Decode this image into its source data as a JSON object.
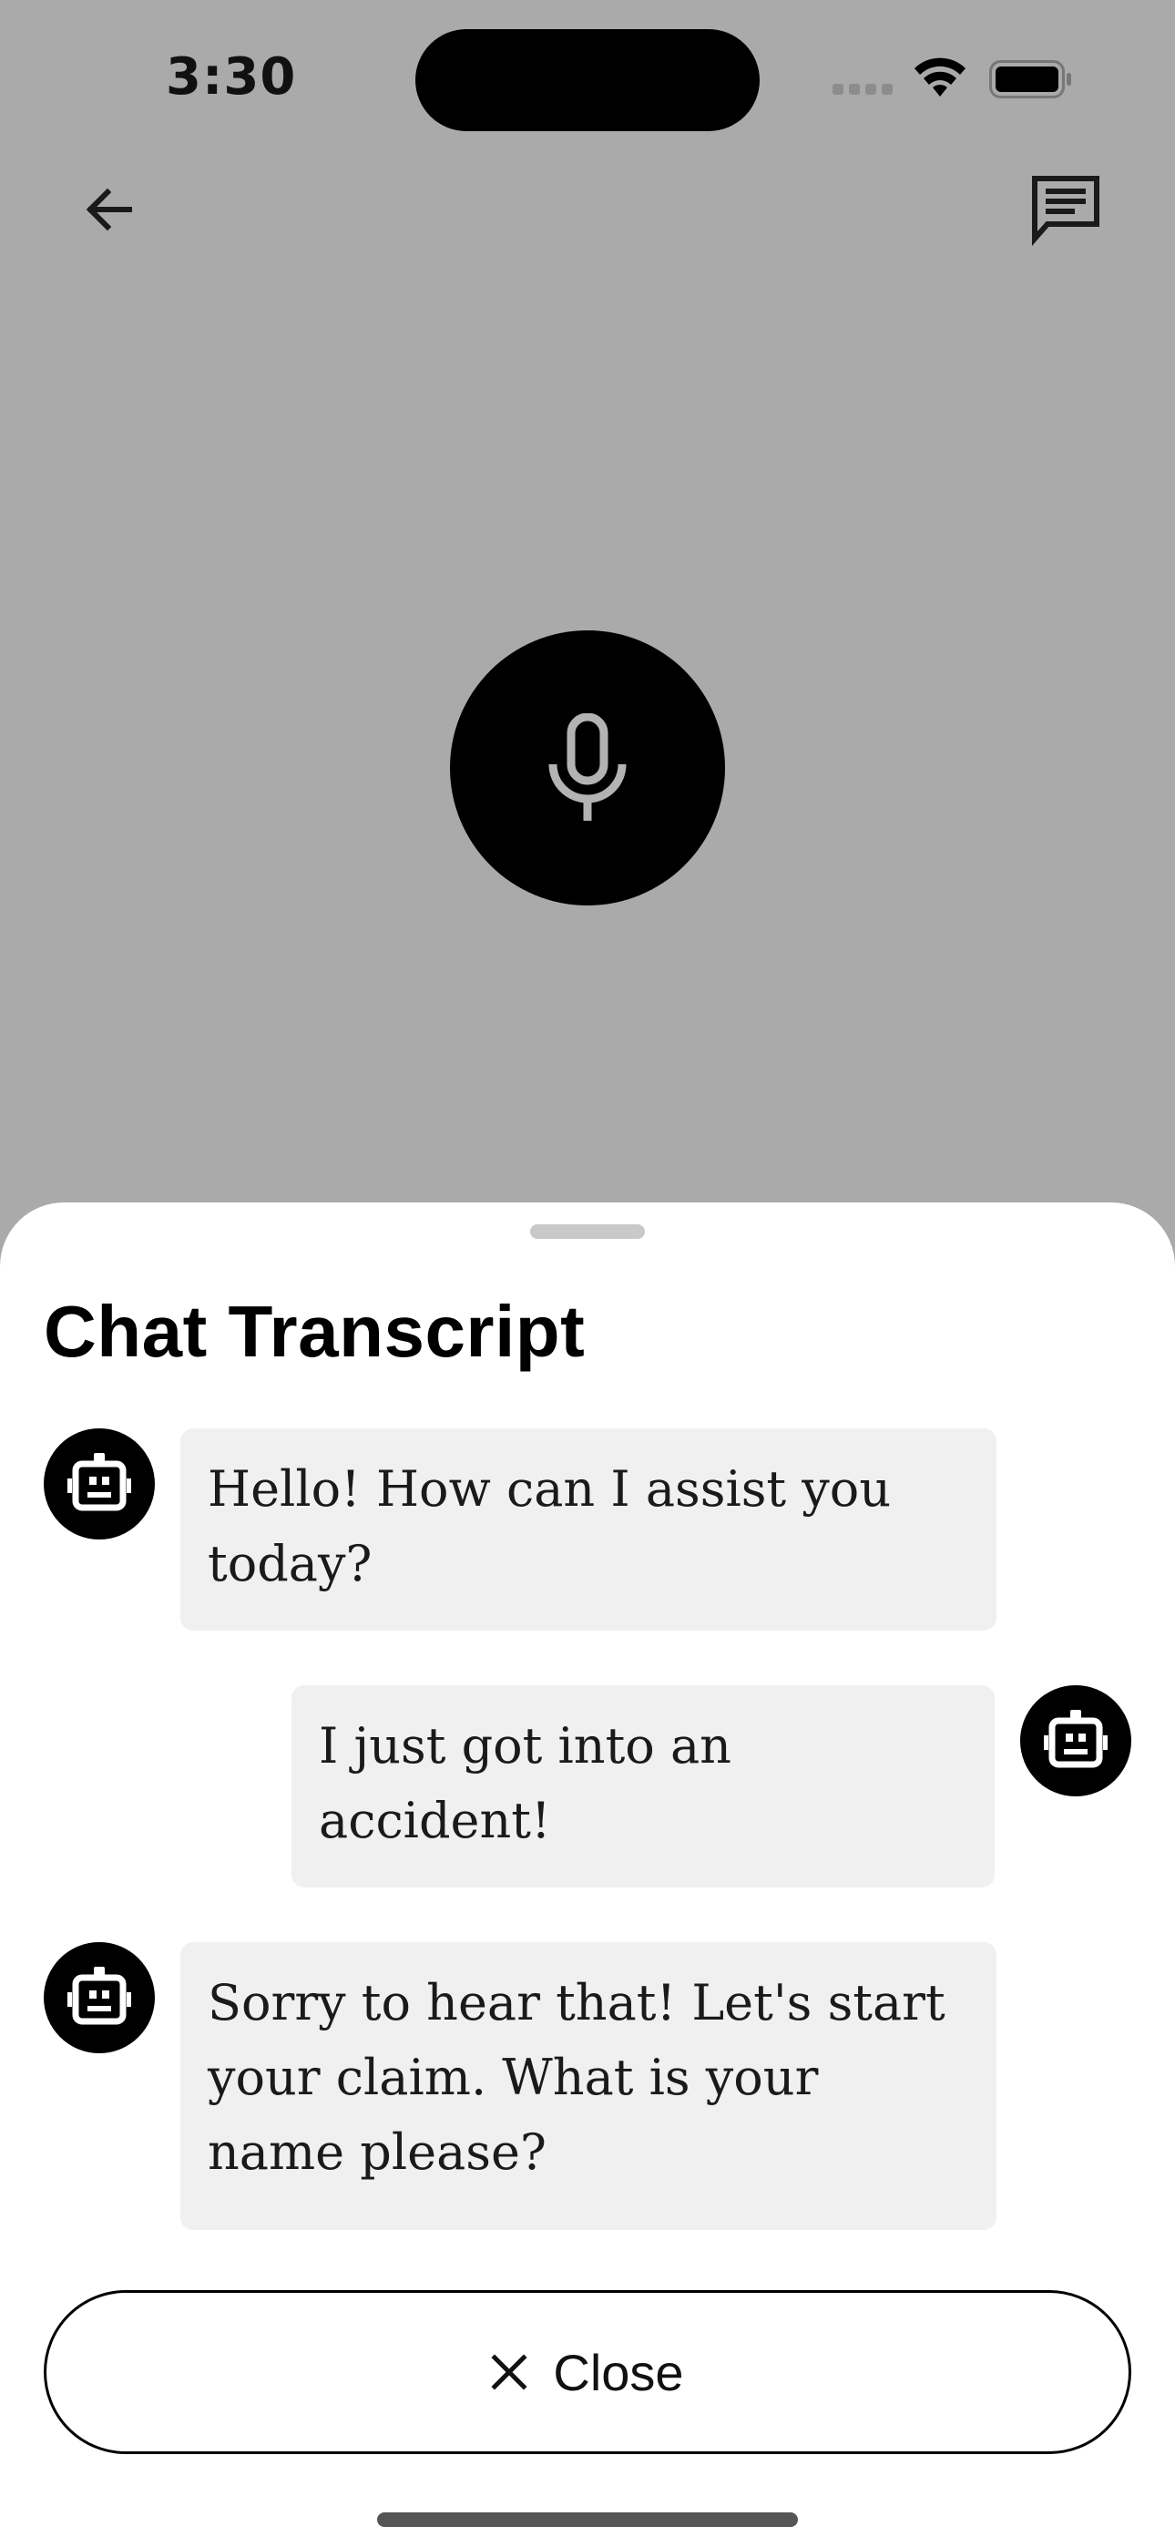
{
  "status_bar": {
    "time": "3:30"
  },
  "header": {
    "back_icon": "arrow-left-icon",
    "chat_icon": "chat-message-icon"
  },
  "voice": {
    "mic_icon": "microphone-icon"
  },
  "transcript": {
    "title": "Chat Transcript",
    "messages": [
      {
        "sender": "bot",
        "text": "Hello! How can I assist you today?"
      },
      {
        "sender": "user",
        "text": "I just got into an accident!"
      },
      {
        "sender": "bot",
        "text": "Sorry to hear that! Let's start your claim. What is your name please?"
      }
    ],
    "avatar_icon": "robot-icon",
    "close_label": "Close",
    "close_icon": "close-x-icon"
  },
  "colors": {
    "background_dim": "#aaaaaa",
    "bubble": "#f0f0f0",
    "sheet": "#ffffff",
    "mic_circle": "#000000"
  }
}
